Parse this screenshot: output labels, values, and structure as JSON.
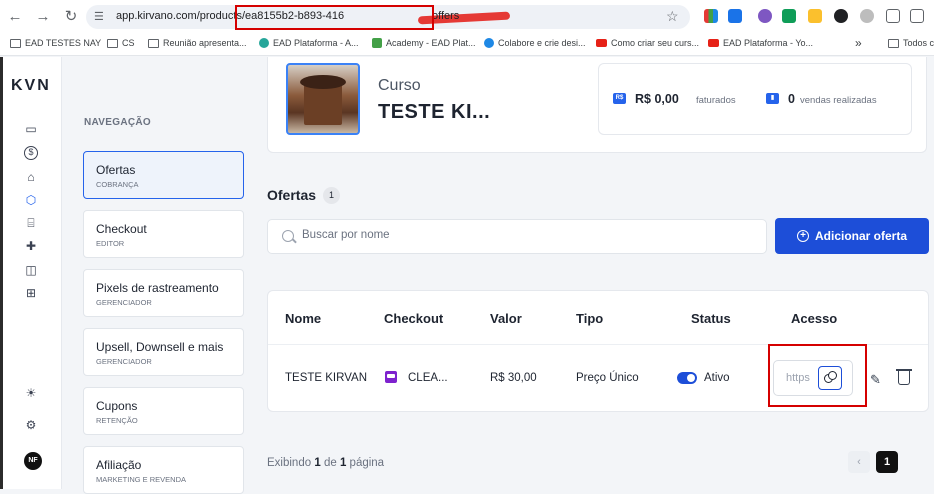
{
  "browser": {
    "url_prefix": "app.kirvano.com/products/",
    "url_id_part": "ea8155b2-b893-416",
    "url_suffix": "offers",
    "bookmarks": [
      {
        "label": "EAD TESTES NAY",
        "icon": "folder-icon"
      },
      {
        "label": "CS",
        "icon": "folder-icon"
      },
      {
        "label": "Reunião apresenta...",
        "icon": "folder-icon"
      },
      {
        "label": "EAD Plataforma - A...",
        "icon": "site-icon"
      },
      {
        "label": "Academy - EAD Plat...",
        "icon": "site-icon"
      },
      {
        "label": "Colabore e crie desi...",
        "icon": "site-icon"
      },
      {
        "label": "Como criar seu curs...",
        "icon": "youtube-icon"
      },
      {
        "label": "EAD Plataforma - Yo...",
        "icon": "youtube-icon"
      },
      {
        "label": "Todos c",
        "icon": "folder-icon"
      }
    ],
    "bookmarks_overflow": "»"
  },
  "app": {
    "logo": "KVN",
    "avatar_initials": "NF"
  },
  "subnav": {
    "title": "NAVEGAÇÃO",
    "items": [
      {
        "label": "Ofertas",
        "sub": "COBRANÇA",
        "active": true
      },
      {
        "label": "Checkout",
        "sub": "EDITOR"
      },
      {
        "label": "Pixels de rastreamento",
        "sub": "GERENCIADOR"
      },
      {
        "label": "Upsell, Downsell e mais",
        "sub": "GERENCIADOR"
      },
      {
        "label": "Cupons",
        "sub": "RETENÇÃO"
      },
      {
        "label": "Afiliação",
        "sub": "MARKETING E REVENDA"
      }
    ]
  },
  "product": {
    "type_label": "Curso",
    "name": "TESTE KI...",
    "revenue_value": "R$ 0,00",
    "revenue_label": "faturados",
    "sales_value": "0",
    "sales_label": "vendas realizadas"
  },
  "offers": {
    "title": "Ofertas",
    "count": "1",
    "search_placeholder": "Buscar por nome",
    "add_button": "Adicionar oferta",
    "columns": [
      "Nome",
      "Checkout",
      "Valor",
      "Tipo",
      "Status",
      "Acesso"
    ],
    "rows": [
      {
        "name": "TESTE KIRVANO",
        "checkout": "CLEA...",
        "value": "R$ 30,00",
        "type": "Preço Único",
        "status": "Ativo",
        "access": "https"
      }
    ],
    "footer_prefix": "Exibindo",
    "footer_from": "1",
    "footer_mid": "de",
    "footer_total": "1",
    "footer_suffix": "página",
    "page_current": "1",
    "page_prev": "‹"
  },
  "colors": {
    "primary": "#1d4ed8",
    "highlight": "#d50000"
  }
}
